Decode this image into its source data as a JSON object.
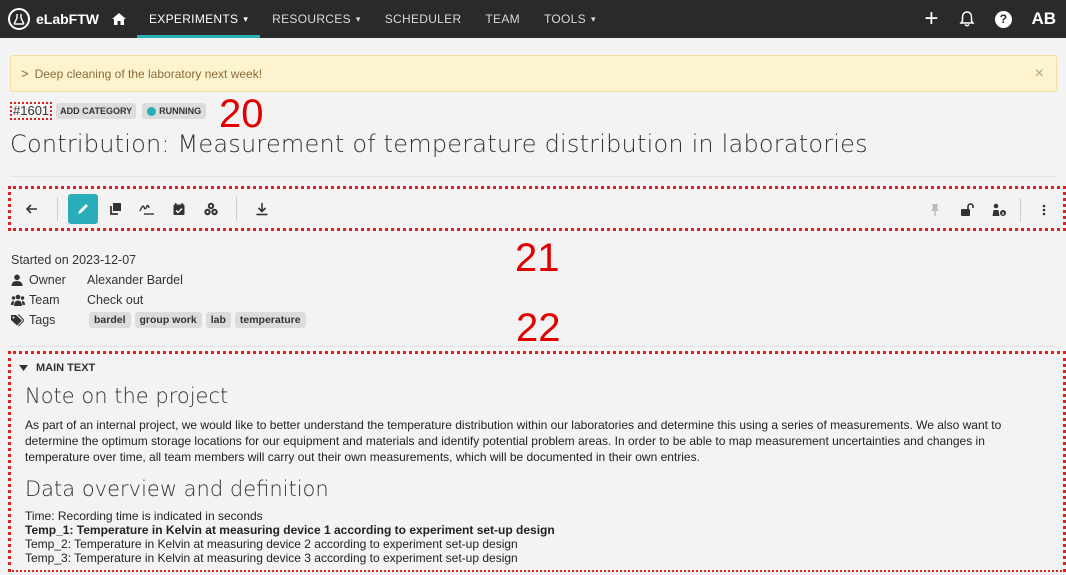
{
  "navbar": {
    "brand": "eLabFTW",
    "items": [
      {
        "label": "EXPERIMENTS",
        "caret": "▾"
      },
      {
        "label": "RESOURCES",
        "caret": "▾"
      },
      {
        "label": "SCHEDULER",
        "caret": ""
      },
      {
        "label": "TEAM",
        "caret": ""
      },
      {
        "label": "TOOLS",
        "caret": "▾"
      }
    ],
    "add": "+",
    "help": "?",
    "avatar": "AB",
    "accent": "#29aeb9"
  },
  "alert": {
    "chevron": ">",
    "text": "Deep cleaning of the laboratory next week!",
    "close": "×"
  },
  "experiment": {
    "id": "#1601",
    "add_category": "ADD CATEGORY",
    "status": "RUNNING",
    "title": "Contribution: Measurement of temperature distribution in laboratories"
  },
  "annotations": {
    "a20": "20",
    "a21": "21",
    "a22": "22"
  },
  "info": {
    "started": "Started on 2023-12-07",
    "owner_label": "Owner",
    "owner": "Alexander Bardel",
    "team_label": "Team",
    "team": "Check out",
    "tags_label": "Tags",
    "tags": [
      "bardel",
      "group work",
      "lab",
      "temperature"
    ]
  },
  "main": {
    "header": "MAIN TEXT",
    "h1": "Note on the project",
    "paragraph": "As part of an internal project, we would like to better understand the temperature distribution within our laboratories and determine this using a series of measurements. We also want to determine the optimum storage locations for our equipment and materials and identify potential problem areas. In order to be able to map measurement uncertainties and changes in temperature over time, all team members will carry out their own measurements, which will be documented in their own entries.",
    "h2": "Data overview and definition",
    "lines": [
      "Time: Recording time is indicated in seconds",
      "Temp_1: Temperature in Kelvin at measuring device 1 according to experiment set-up design",
      "Temp_2: Temperature in Kelvin at measuring device 2 according to experiment set-up design",
      "Temp_3: Temperature in Kelvin at measuring device 3 according to experiment set-up design"
    ]
  }
}
